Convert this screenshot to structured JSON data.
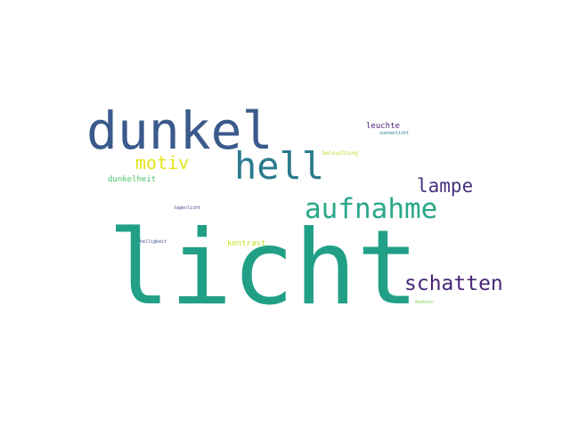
{
  "words": [
    {
      "id": "licht",
      "text": "licht",
      "color": "#21a087"
    },
    {
      "id": "dunkel",
      "text": "dunkel",
      "color": "#3b5a8c"
    },
    {
      "id": "hell",
      "text": "hell",
      "color": "#2b7a8e"
    },
    {
      "id": "aufnahme",
      "text": "aufnahme",
      "color": "#2aa88a"
    },
    {
      "id": "schatten",
      "text": "schatten",
      "color": "#482677"
    },
    {
      "id": "lampe",
      "text": "lampe",
      "color": "#46327e"
    },
    {
      "id": "motiv",
      "text": "motiv",
      "color": "#e3e418"
    },
    {
      "id": "dunkelheit",
      "text": "dunkelheit",
      "color": "#4ac16d"
    },
    {
      "id": "leuchte",
      "text": "leuchte",
      "color": "#482677"
    },
    {
      "id": "sonnenlicht",
      "text": "sonnenlicht",
      "color": "#287c8e"
    },
    {
      "id": "beleuchtung",
      "text": "beleuchtung",
      "color": "#bddf26"
    },
    {
      "id": "tageslicht",
      "text": "tageslicht",
      "color": "#3e4a89"
    },
    {
      "id": "kontrast",
      "text": "kontrast",
      "color": "#c8e020"
    },
    {
      "id": "helligkeit",
      "text": "helligkeit",
      "color": "#3e4a89"
    },
    {
      "id": "dunkeln",
      "text": "dunkeln",
      "color": "#7ad151"
    }
  ]
}
